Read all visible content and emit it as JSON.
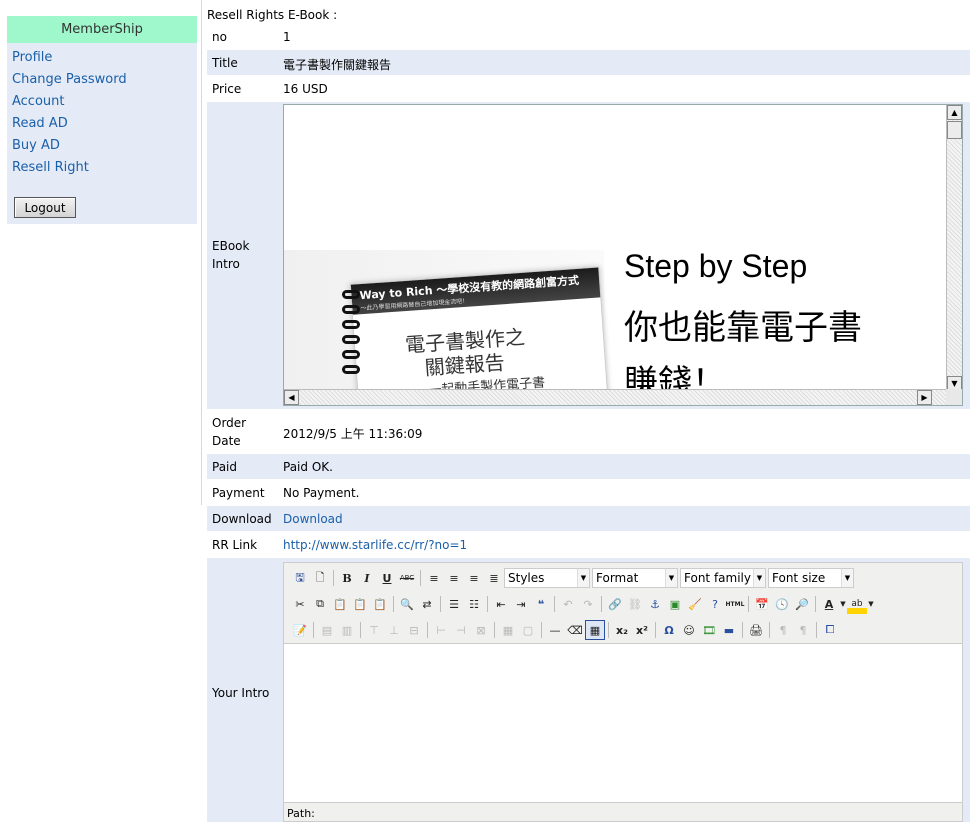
{
  "sidebar": {
    "title": "MemberShip",
    "items": [
      "Profile",
      "Change Password",
      "Account",
      "Read AD",
      "Buy AD",
      "Resell Right"
    ],
    "logout": "Logout"
  },
  "heading": "Resell Rights E-Book :",
  "fields": {
    "no": {
      "label": "no",
      "value": "1"
    },
    "title": {
      "label": "Title",
      "value": "電子書製作關鍵報告"
    },
    "price": {
      "label": "Price",
      "value": "16 USD"
    },
    "ebook_intro": {
      "label_line1": "EBook",
      "label_line2": "Intro"
    },
    "order_date": {
      "label_line1": "Order",
      "label_line2": "Date",
      "value": "2012/9/5 上午 11:36:09"
    },
    "paid": {
      "label": "Paid",
      "value": "Paid OK."
    },
    "payment": {
      "label": "Payment",
      "value": "No Payment."
    },
    "download": {
      "label": "Download",
      "value": "Download"
    },
    "rr_link": {
      "label": "RR Link",
      "value": "http://www.starlife.cc/rr/?no=1"
    },
    "your_intro": {
      "label": "Your Intro"
    }
  },
  "ebook_image": {
    "band_title": "Way to Rich ～學校沒有教的網路創富方式",
    "band_sub": "～此乃學習用網路替自己增加現金流吧！",
    "book_title_line1": "電子書製作之",
    "book_title_line2": "關鍵報告",
    "book_sub": "一起動手製作電子書",
    "promo_line1": "Step by Step",
    "promo_line2": "你也能靠電子書",
    "promo_line3": "賺錢！"
  },
  "editor": {
    "styles": "Styles",
    "format": "Format",
    "font_family": "Font family",
    "font_size": "Font size",
    "path_label": "Path:"
  },
  "colors": {
    "sidebar_head": "#9ff7cc",
    "row_alt": "#e4ebf7",
    "link": "#1a5fa8"
  }
}
